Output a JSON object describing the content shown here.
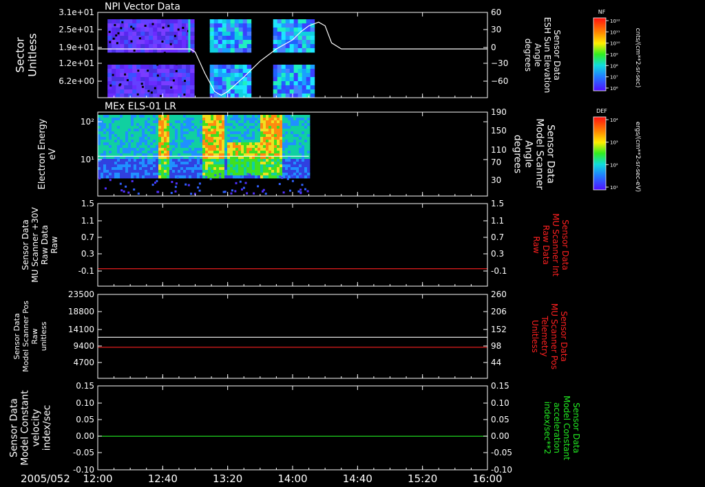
{
  "colors": {
    "background": "#000000",
    "axis": "#ffffff",
    "red_trace": "#ff2020",
    "green_trace": "#22ee22",
    "white_trace": "#ffffff"
  },
  "time_axis": {
    "date_label": "2005/052",
    "ticks": [
      "12:00",
      "12:40",
      "13:20",
      "14:00",
      "14:40",
      "15:20",
      "16:00"
    ],
    "range": [
      "12:00",
      "16:00"
    ]
  },
  "chart_data": [
    {
      "type": "heatmap",
      "title": "NPI Vector Data",
      "ylabel": [
        "Sector",
        "Unitless"
      ],
      "yticks": [
        "3.1e+01",
        "2.5e+01",
        "1.9e+01",
        "1.2e+01",
        "6.2e+00"
      ],
      "right_label": [
        "Sensor Data",
        "ESH Sun Elevation",
        "Angle",
        "degrees"
      ],
      "right_ticks": [
        "60",
        "30",
        "0",
        "−30",
        "−60"
      ],
      "right_range": [
        -80,
        60
      ],
      "colorbar": {
        "label": "NF",
        "ticks": [
          "10¹²",
          "10¹¹",
          "10¹⁰",
          "10⁹",
          "10⁸",
          "10⁷",
          "10⁶"
        ],
        "unit": "cnts/(cm**2-sr-sec)"
      },
      "data_blocks": [
        {
          "x": [
            "12:06",
            "12:57"
          ],
          "level": "low"
        },
        {
          "x": [
            "13:09",
            "13:33"
          ],
          "level": "mid"
        },
        {
          "x": [
            "13:48",
            "14:12"
          ],
          "level": "mid"
        }
      ],
      "series": [
        {
          "x": [
            "12:00",
            "12:57",
            "13:00",
            "13:06",
            "13:12",
            "13:16",
            "13:20",
            "13:30",
            "13:40",
            "13:50",
            "14:00",
            "14:05",
            "14:10",
            "14:16",
            "14:20",
            "14:24",
            "14:30",
            "16:00"
          ],
          "values": [
            0,
            0,
            -5,
            -40,
            -70,
            -76,
            -70,
            -46,
            -20,
            0,
            15,
            28,
            38,
            44,
            38,
            10,
            0,
            0
          ]
        }
      ]
    },
    {
      "type": "heatmap",
      "title": "MEx ELS-01 LR",
      "ylabel": [
        "Electron Energy",
        "eV"
      ],
      "yticks": [
        "10²",
        "10¹"
      ],
      "right_label": [
        "Sensor Data",
        "Model Scanner",
        "Angle",
        "degrees"
      ],
      "right_ticks": [
        "190",
        "150",
        "110",
        "70",
        "30"
      ],
      "right_range": [
        0,
        190
      ],
      "colorbar": {
        "label": "DEF",
        "ticks": [
          "10⁴",
          "10³",
          "10²",
          "10¹"
        ],
        "unit": "ergs/(cm**2-sr-sec-eV)"
      },
      "data_range": [
        "12:00",
        "14:10"
      ],
      "series": [
        {
          "x": [
            "12:00",
            "14:10"
          ],
          "values": [
            90,
            90
          ]
        }
      ]
    },
    {
      "type": "line",
      "ylabel": [
        "Sensor Data",
        "MU Scanner +30V",
        "Raw Data",
        "Raw"
      ],
      "yticks": [
        "1.5",
        "1.1",
        "0.7",
        "0.3",
        "-0.1"
      ],
      "right_label": [
        "Sensor Data",
        "MU Scanner Int",
        "Raw Data",
        "Raw"
      ],
      "right_ticks": [
        "1.5",
        "1.1",
        "0.7",
        "0.3",
        "-0.1"
      ],
      "ylim": [
        -0.4,
        1.5
      ],
      "series": [
        {
          "x": [
            "12:00",
            "16:00"
          ],
          "values": [
            0,
            0
          ]
        }
      ]
    },
    {
      "type": "line",
      "ylabel": [
        "Sensor Data",
        "Model Scanner Pos",
        "Raw",
        "unitless"
      ],
      "yticks": [
        "23500",
        "18800",
        "14100",
        "9400",
        "4700"
      ],
      "right_label": [
        "Sensor Data",
        "MU Scanner Pos",
        "Telemetry",
        "Unitless"
      ],
      "right_ticks": [
        "260",
        "206",
        "152",
        "98",
        "44"
      ],
      "ylim": [
        0,
        23500
      ],
      "right_ylim": [
        -10,
        260
      ],
      "series": [
        {
          "axis": "left",
          "x": [
            "12:00",
            "16:00"
          ],
          "values": [
            11500,
            11500
          ]
        },
        {
          "axis": "right",
          "x": [
            "12:00",
            "16:00"
          ],
          "values": [
            90,
            90
          ]
        }
      ]
    },
    {
      "type": "line",
      "ylabel": [
        "Sensor Data",
        "Model Constant",
        "velocity",
        "index/sec"
      ],
      "yticks": [
        "0.15",
        "0.10",
        "0.05",
        "0.00",
        "-0.05",
        "-0.10"
      ],
      "right_label": [
        "Sensor Data",
        "Model Constant",
        "acceleration",
        "index/sec**2"
      ],
      "right_ticks": [
        "0.15",
        "0.10",
        "0.05",
        "0.00",
        "-0.05",
        "-0.10"
      ],
      "ylim": [
        -0.1,
        0.15
      ],
      "series": [
        {
          "x": [
            "12:00",
            "16:00"
          ],
          "values": [
            0,
            0
          ]
        }
      ]
    }
  ]
}
